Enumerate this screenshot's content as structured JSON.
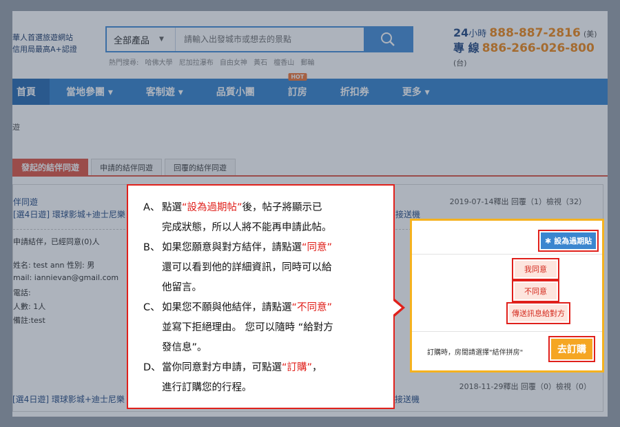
{
  "header": {
    "brand_line1": "華人首選旅遊網站",
    "brand_line2": "信用局最高A+認證",
    "search": {
      "category": "全部產品",
      "placeholder": "請輸入出發城市或想去的景點"
    },
    "hot_search": "熱門搜尋: 哈佛大學 尼加拉瀑布 自由女神 黃石 檀香山 郵輪",
    "hotline": {
      "label1_num": "24",
      "label1_text": "小時",
      "label2": "專 線",
      "phone_us": "888-887-2816",
      "region_us": "(美)",
      "phone_tw": "886-266-026-800",
      "region_tw": "(台)"
    }
  },
  "nav": {
    "items": [
      "首頁",
      "當地參團 ▾",
      "客制遊 ▾",
      "品質小團",
      "訂房",
      "折扣券",
      "更多 ▾"
    ],
    "hot_badge": "HOT"
  },
  "breadcrumb": "遊",
  "tabs": [
    "發起的結伴同遊",
    "申請的結伴同遊",
    "回覆的結伴同遊"
  ],
  "post1": {
    "title": "伴同遊",
    "subtitle": "[選4日遊] 環球影城+迪士尼樂",
    "meta": "2019-07-14釋出 回覆（1）檢視（32）",
    "right_text": "接送機",
    "apply_status": "申請結伴，已經同意(0)人",
    "details": [
      "姓名: test ann 性別: 男",
      "mail: iannievan@gmail.com",
      "電話:",
      "人數: 1人",
      "備註:test"
    ]
  },
  "post2": {
    "meta": "2018-11-29釋出 回覆（0）檢視（0）",
    "subtitle": "[選4日遊] 環球影城+迪士尼樂",
    "right_text": "接送機"
  },
  "panel": {
    "expire_label": "設為過期貼",
    "agree_label": "我同意",
    "disagree_label": "不同意",
    "send_label": "傳送訊息給對方",
    "note": "訂購時，房間請選擇\"結伴拼房\"",
    "order_label": "去訂購"
  },
  "instructions": {
    "a_label": "A、",
    "a_text1": "點選",
    "a_hl": "“設為過期帖”",
    "a_text2": "後，帖子將顯示已",
    "a_text3": "完成狀態，所以人將不能再申請此帖。",
    "b_label": "B、",
    "b_text1": "如果您願意與對方結伴，請點選",
    "b_hl": "“同意”",
    "b_text2": "還可以看到他的詳細資訊，同時可以給",
    "b_text3": "他留言。",
    "c_label": "C、",
    "c_text1": "如果您不願與他結伴，請點選",
    "c_hl": "“不同意”",
    "c_text2": "並寫下拒絕理由。 您可以隨時 “給對方",
    "c_text3": "發信息”。",
    "d_label": "D、",
    "d_text1": "當你同意對方申請，可點選",
    "d_hl": "“訂購”",
    "d_text2": "，",
    "d_text3": "進行訂購您的行程。"
  }
}
